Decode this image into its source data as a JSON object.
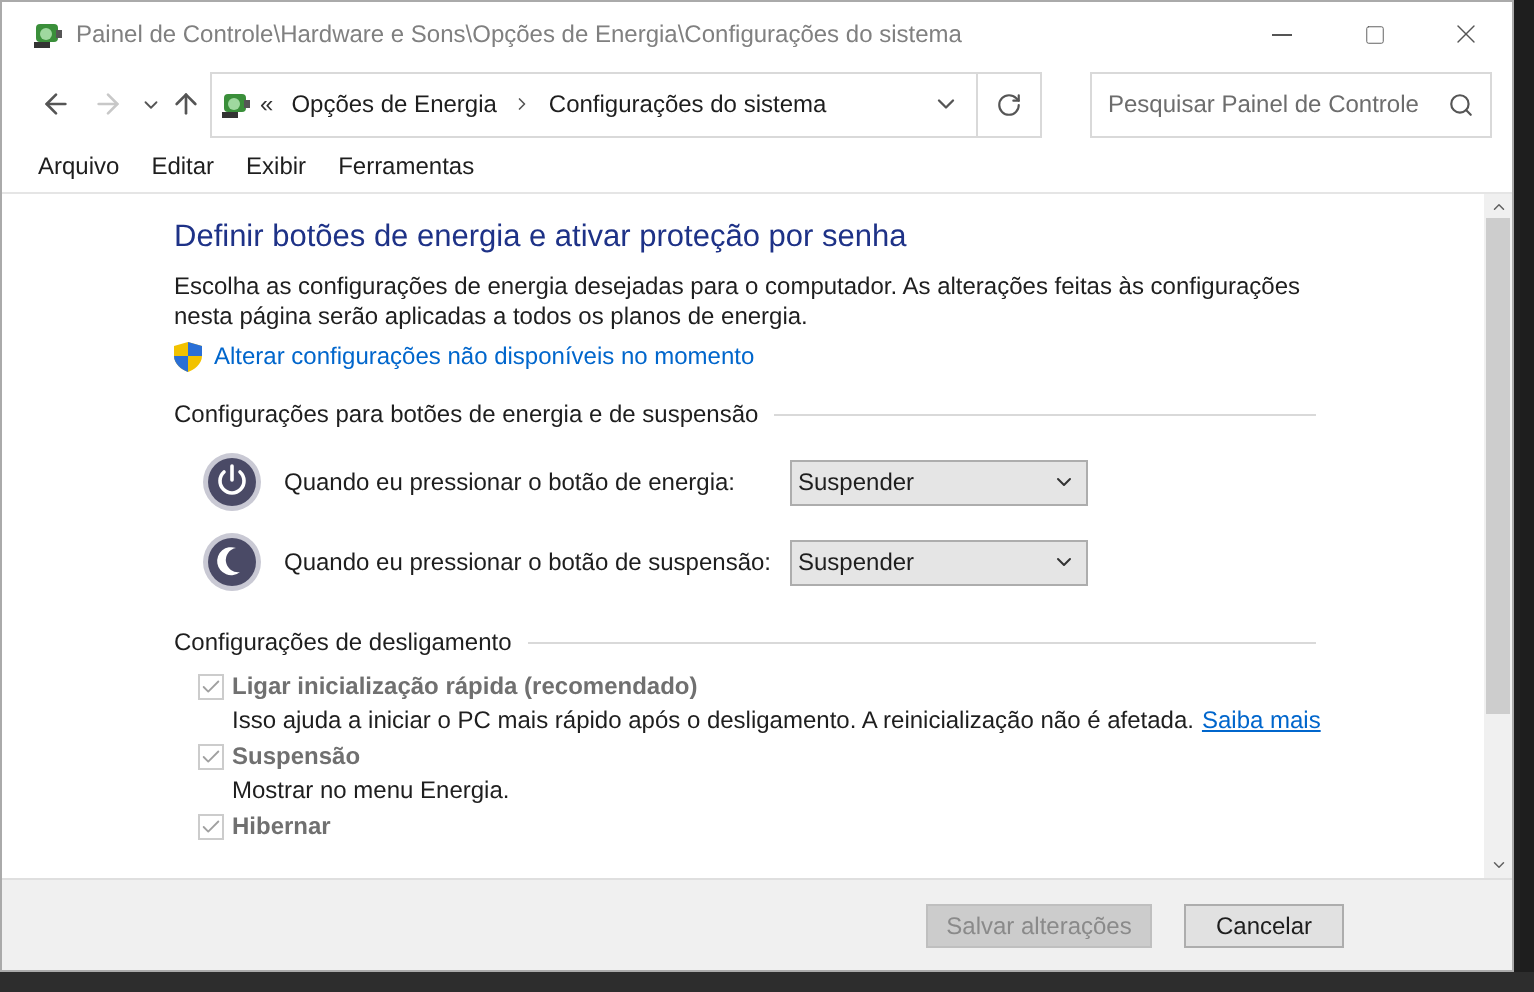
{
  "window": {
    "title": "Painel de Controle\\Hardware e Sons\\Opções de Energia\\Configurações do sistema"
  },
  "address_bar": {
    "overflow": "«",
    "crumbs": [
      "Opções de Energia",
      "Configurações do sistema"
    ]
  },
  "search": {
    "placeholder": "Pesquisar Painel de Controle"
  },
  "menu": [
    "Arquivo",
    "Editar",
    "Exibir",
    "Ferramentas"
  ],
  "heading": "Definir botões de energia e ativar proteção por senha",
  "intro": "Escolha as configurações de energia desejadas para o computador. As alterações feitas às configurações nesta página serão aplicadas a todos os planos de energia.",
  "admin_link": "Alterar configurações não disponíveis no momento",
  "button_section": {
    "title": "Configurações para botões de energia e de suspensão",
    "rows": [
      {
        "kind": "power",
        "label": "Quando eu pressionar o botão de energia:",
        "value": "Suspender"
      },
      {
        "kind": "sleep",
        "label": "Quando eu pressionar o botão de suspensão:",
        "value": "Suspender"
      }
    ]
  },
  "shutdown_section": {
    "title": "Configurações de desligamento",
    "options": [
      {
        "label": "Ligar inicialização rápida (recomendado)",
        "checked": true,
        "disabled": true,
        "description": "Isso ajuda a iniciar o PC mais rápido após o desligamento. A reinicialização não é afetada.",
        "link": "Saiba mais"
      },
      {
        "label": "Suspensão",
        "checked": true,
        "disabled": true,
        "description": "Mostrar no menu Energia."
      },
      {
        "label": "Hibernar",
        "checked": true,
        "disabled": true
      }
    ]
  },
  "footer": [
    {
      "label": "Salvar alterações",
      "disabled": true
    },
    {
      "label": "Cancelar",
      "disabled": false
    }
  ]
}
